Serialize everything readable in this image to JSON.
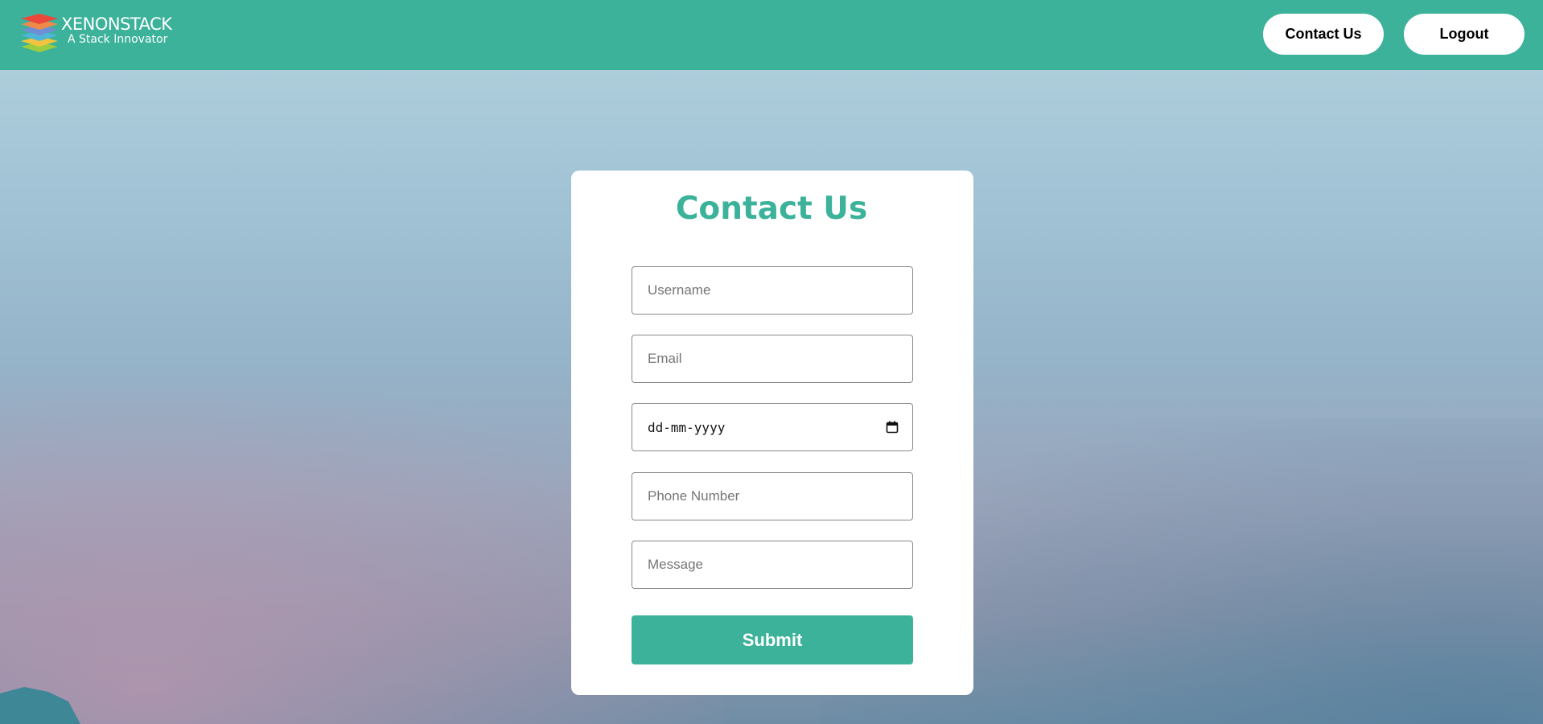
{
  "brand": {
    "name": "XENONSTACK",
    "tagline": "A Stack Innovator",
    "logo_icon": "stacked-layers-logo"
  },
  "nav": {
    "contact_label": "Contact Us",
    "logout_label": "Logout"
  },
  "form": {
    "title": "Contact Us",
    "username_placeholder": "Username",
    "email_placeholder": "Email",
    "date_placeholder": "dd-mm-yyyy",
    "phone_placeholder": "Phone Number",
    "message_placeholder": "Message",
    "submit_label": "Submit"
  },
  "colors": {
    "accent": "#3cb29a",
    "card": "#ffffff"
  }
}
